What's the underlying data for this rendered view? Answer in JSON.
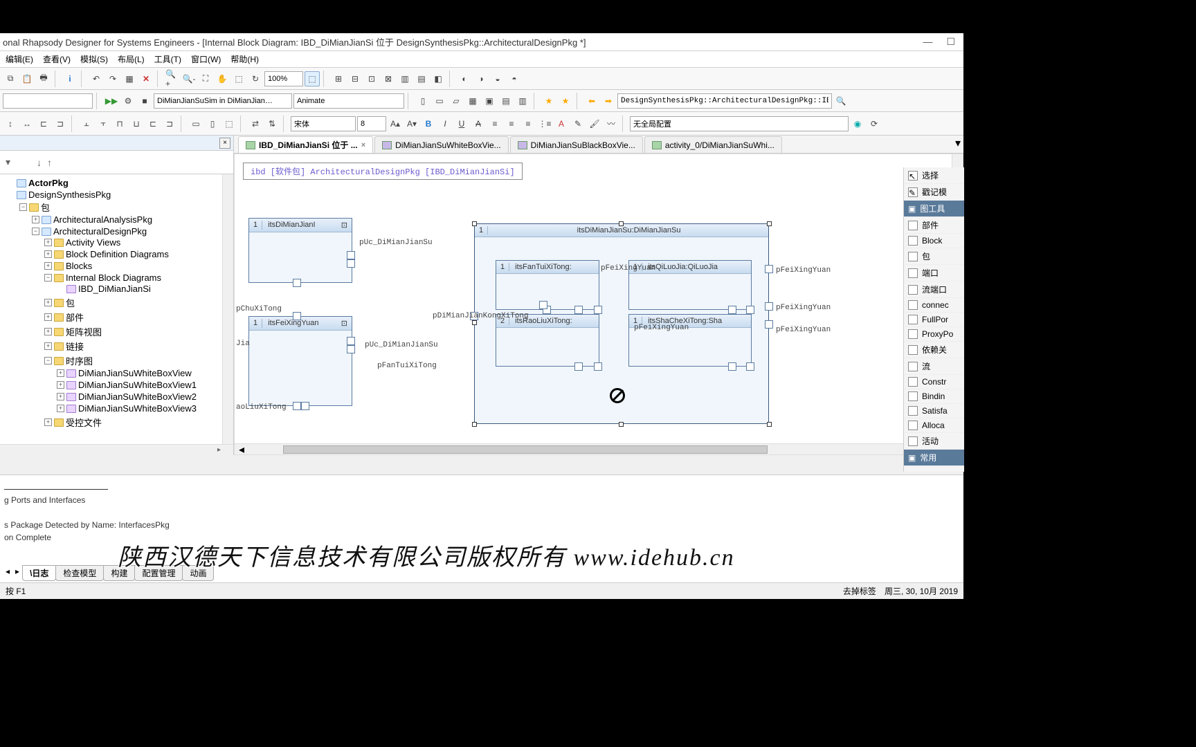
{
  "title": "onal Rhapsody Designer for Systems Engineers - [Internal Block Diagram: IBD_DiMianJianSi 位于 DesignSynthesisPkg::ArchitecturalDesignPkg *]",
  "menu": {
    "edit": "编辑(E)",
    "view": "查看(V)",
    "sim": "模拟(S)",
    "layout": "布局(L)",
    "tools": "工具(T)",
    "window": "窗口(W)",
    "help": "帮助(H)"
  },
  "toolbar": {
    "zoom": "100%",
    "config_combo": "DiMianJianSuSim in DiMianJian…",
    "mode": "Animate",
    "path": "DesignSynthesisPkg::ArchitecturalDesignPkg::IB",
    "font": "宋体",
    "fontsize": "8",
    "layoutcfg": "无全局配置"
  },
  "tree": {
    "n1": "ActorPkg",
    "n2": "DesignSynthesisPkg",
    "n3": "包",
    "n4": "ArchitecturalAnalysisPkg",
    "n5": "ArchitecturalDesignPkg",
    "n6": "Activity Views",
    "n7": "Block Definition Diagrams",
    "n8": "Blocks",
    "n9": "Internal Block Diagrams",
    "n10": "IBD_DiMianJianSi",
    "n11": "包",
    "n12": "部件",
    "n13": "矩阵视图",
    "n14": "链接",
    "n15": "时序图",
    "n16": "DiMianJianSuWhiteBoxView",
    "n17": "DiMianJianSuWhiteBoxView1",
    "n18": "DiMianJianSuWhiteBoxView2",
    "n19": "DiMianJianSuWhiteBoxView3",
    "n20": "受控文件"
  },
  "tabs": {
    "t1": "IBD_DiMianJianSi 位于 ...",
    "t2": "DiMianJianSuWhiteBoxVie...",
    "t3": "DiMianJianSuBlackBoxVie...",
    "t4": "activity_0/DiMianJianSuWhi..."
  },
  "canvas": {
    "header": "ibd [软件包] ArchitecturalDesignPkg [IBD_DiMianJianSi]",
    "b1": {
      "n": "1",
      "t": "itsDiMianJianI"
    },
    "b2": {
      "n": "1",
      "t": "itsFeiXingYuan"
    },
    "b3": {
      "n": "1",
      "t": "itsDiMianJianSu:DiMianJianSu"
    },
    "b4": {
      "n": "1",
      "t": "itsFanTuiXiTong:"
    },
    "b5": {
      "n": "1",
      "t": "itsQiLuoJia:QiLuoJia"
    },
    "b6": {
      "n": "2",
      "t": "itsRaoLiuXiTong:"
    },
    "b7": {
      "n": "1",
      "t": "itsShaCheXiTong:Sha"
    },
    "p1": "pUc_DiMianJianSu",
    "p2": "pChuXiTong",
    "p3": "pUc_DiMianJianSu",
    "p4": "pFanTuiXiTong",
    "p5": "pDiMianJianKongXiTong",
    "p6": "pFeiXingYuan",
    "p7": "pFeiXingYuan",
    "p8": "pFeiXingYuan",
    "p9": "pFeiXingYuan",
    "p10": "pFeiXingYuan",
    "p11": "aoLiuXiTong",
    "p12": "Jia"
  },
  "palette": {
    "h0": "选择",
    "h1": "戳记模",
    "hdr": "图工具",
    "i1": "部件",
    "i2": "Block",
    "i3": "包",
    "i4": "端口",
    "i5": "流端口",
    "i6": "connec",
    "i7": "FullPor",
    "i8": "ProxyPo",
    "i9": "依赖关",
    "i10": "流",
    "i11": "Constr",
    "i12": "Bindin",
    "i13": "Satisfa",
    "i14": "Alloca",
    "i15": "活动",
    "hdr2": "常用"
  },
  "log": {
    "l1": "g Ports and Interfaces",
    "l2": "s Package Detected by Name: InterfacesPkg",
    "l3": "on Complete"
  },
  "bottomtabs": {
    "t1": "日志",
    "t2": "检查模型",
    "t3": "构建",
    "t4": "配置管理",
    "t5": "动画"
  },
  "status": {
    "left": "按 F1",
    "right1": "去掉标签",
    "right2": "周三, 30, 10月 2019"
  },
  "watermark": "陕西汉德天下信息技术有限公司版权所有 www.idehub.cn"
}
